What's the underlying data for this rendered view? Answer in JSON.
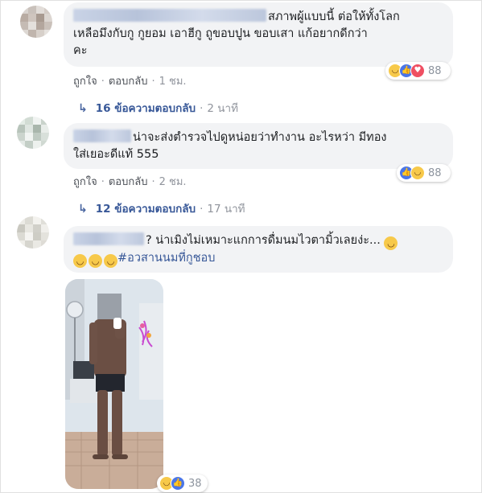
{
  "comments": [
    {
      "text": "สภาพผู้แบบนี้ ต่อให้ทั้งโลกเหลือมึงกับกู กูยอม เอาฮีกู ถูขอบปูน ขอบเสา แก้อยากดีกว่าคะ",
      "line1": "สภาพผู้แบบนี้ ต่อให้ทั้งโลก",
      "line2": "เหลือมึงกับกู กูยอม เอาฮีกู ถูขอบปูน ขอบเสา แก้อยากดีกว่า",
      "line3": "คะ",
      "like_label": "ถูกใจ",
      "reply_label": "ตอบกลับ",
      "time": "1 ชม.",
      "reaction_count": "88",
      "reactions": [
        "haha",
        "like",
        "love"
      ],
      "replies_count": "16 ข้อความตอบกลับ",
      "replies_time": "2 นาที"
    },
    {
      "line1": "น่าจะส่งตำรวจไปดูหน่อยว่าทำงาน อะไรหว่า มีทอง",
      "line2": "ใส่เยอะดีแท้ 555",
      "like_label": "ถูกใจ",
      "reply_label": "ตอบกลับ",
      "time": "2 ชม.",
      "reaction_count": "88",
      "reactions": [
        "like",
        "haha"
      ],
      "replies_count": "12 ข้อความตอบกลับ",
      "replies_time": "17 นาที"
    },
    {
      "line1_tail": "? น่าเมิงไม่เหมาะแกการดื่มนมไวตามิ้วเลยง่ะ...",
      "hashtag": "#อวสานนมที่กูชอบ",
      "reaction_count": "38",
      "reactions": [
        "haha",
        "like"
      ]
    }
  ],
  "colors": {
    "link": "#385898",
    "bubble_bg": "#f2f3f5",
    "meta_text": "#90949c"
  }
}
